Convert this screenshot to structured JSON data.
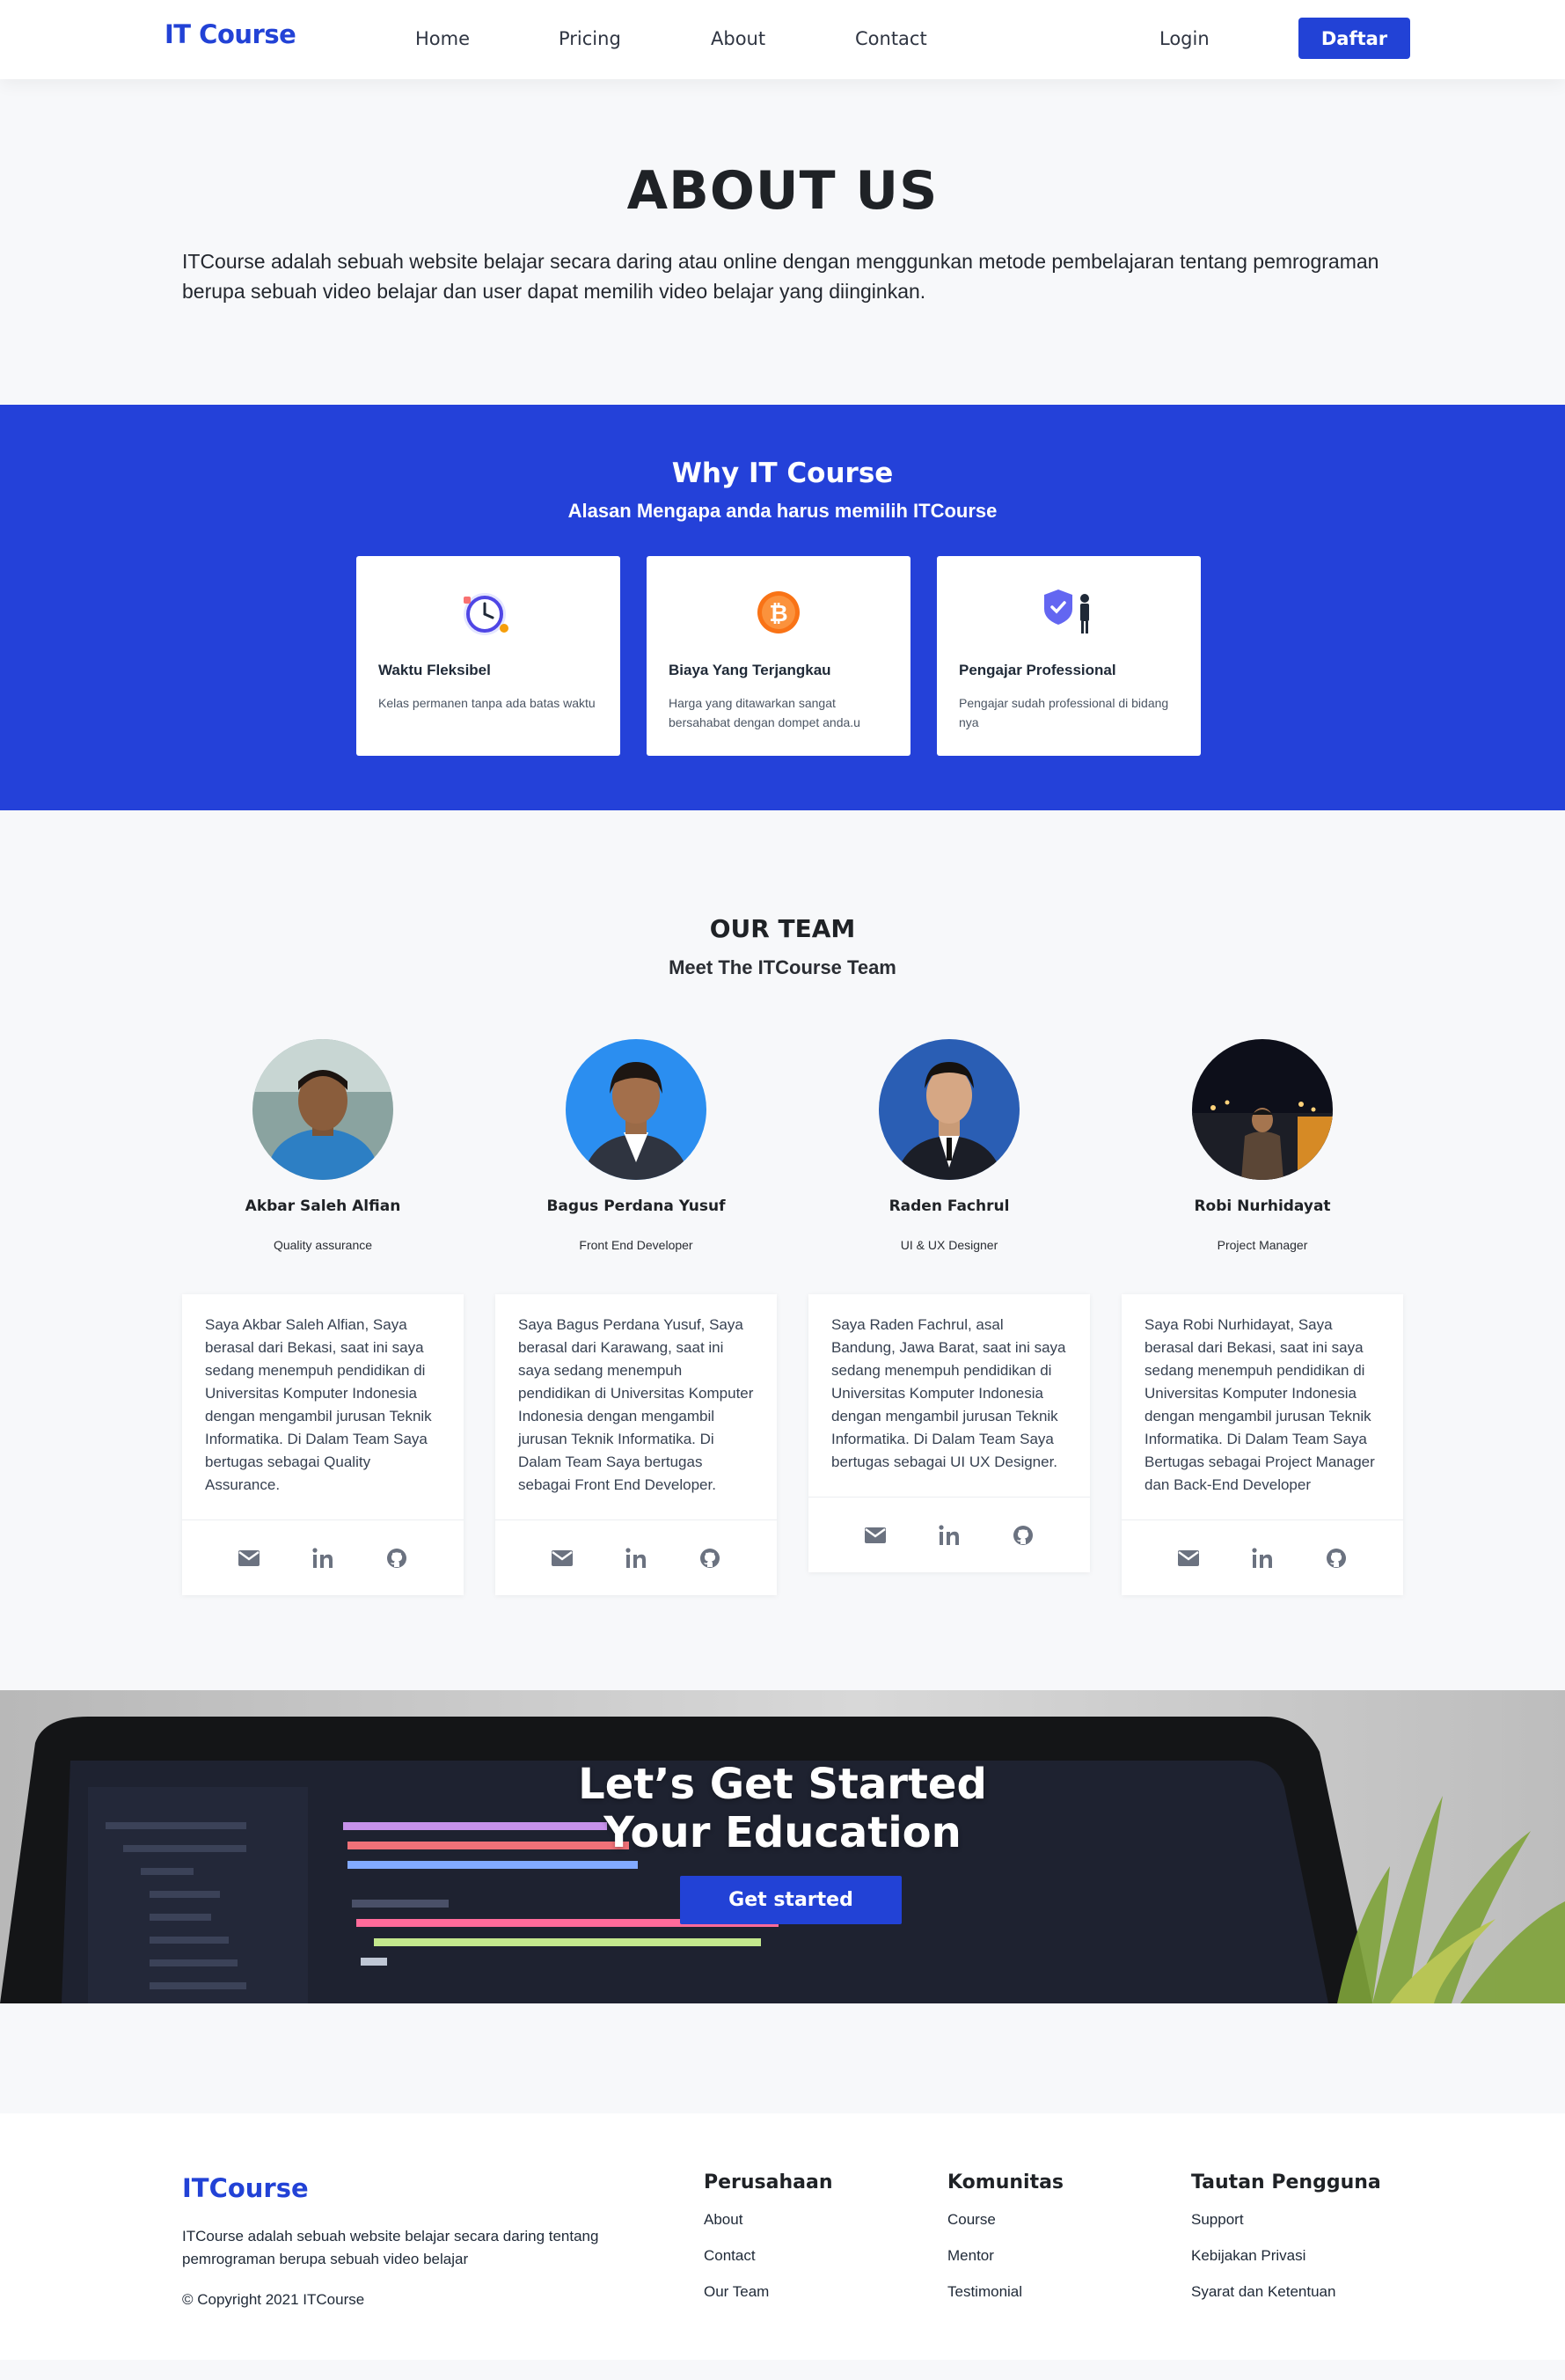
{
  "nav": {
    "brand": "IT Course",
    "links": [
      "Home",
      "Pricing",
      "About",
      "Contact"
    ],
    "login": "Login",
    "register": "Daftar"
  },
  "about": {
    "title": "ABOUT US",
    "text": "ITCourse adalah sebuah website belajar secara daring atau online dengan menggunkan metode pembelajaran tentang pemrograman berupa sebuah video belajar dan user dapat memilih video belajar yang diinginkan."
  },
  "why": {
    "title": "Why IT Course",
    "subtitle": "Alasan Mengapa anda harus memilih ITCourse",
    "features": [
      {
        "icon": "clock-icon",
        "title": "Waktu Fleksibel",
        "desc": "Kelas permanen tanpa ada batas waktu"
      },
      {
        "icon": "bitcoin-icon",
        "title": "Biaya Yang Terjangkau",
        "desc": "Harga yang ditawarkan sangat bersahabat dengan dompet anda.u"
      },
      {
        "icon": "shield-person-icon",
        "title": "Pengajar Professional",
        "desc": "Pengajar sudah professional di bidang nya"
      }
    ]
  },
  "team": {
    "title": "OUR TEAM",
    "subtitle": "Meet The ITCourse Team",
    "members": [
      {
        "name": "Akbar Saleh Alfian",
        "role": "Quality assurance",
        "bio": "Saya Akbar Saleh Alfian, Saya berasal dari Bekasi, saat ini saya sedang menempuh pendidikan di Universitas Komputer Indonesia dengan mengambil jurusan Teknik Informatika. Di Dalam Team Saya bertugas sebagai Quality Assurance."
      },
      {
        "name": "Bagus Perdana Yusuf",
        "role": "Front End Developer",
        "bio": "Saya Bagus Perdana Yusuf, Saya berasal dari Karawang, saat ini saya sedang menempuh pendidikan di Universitas Komputer Indonesia dengan mengambil jurusan Teknik Informatika. Di Dalam Team Saya bertugas sebagai Front End Developer."
      },
      {
        "name": "Raden Fachrul",
        "role": "UI & UX Designer",
        "bio": "Saya Raden Fachrul, asal Bandung, Jawa Barat, saat ini saya sedang menempuh pendidikan di Universitas Komputer Indonesia dengan mengambil jurusan Teknik Informatika. Di Dalam Team Saya bertugas sebagai UI UX Designer."
      },
      {
        "name": "Robi Nurhidayat",
        "role": "Project Manager",
        "bio": "Saya Robi Nurhidayat, Saya berasal dari Bekasi, saat ini saya sedang menempuh pendidikan di Universitas Komputer Indonesia dengan mengambil jurusan Teknik Informatika. Di Dalam Team Saya Bertugas sebagai Project Manager dan Back-End Developer"
      }
    ]
  },
  "hero": {
    "line1": "Let’s Get Started",
    "line2": "Your Education",
    "cta": "Get started"
  },
  "footer": {
    "brand": "ITCourse",
    "desc": "ITCourse adalah sebuah website belajar secara daring tentang pemrograman berupa sebuah video belajar",
    "copyright": "© Copyright 2021 ITCourse",
    "columns": [
      {
        "title": "Perusahaan",
        "links": [
          "About",
          "Contact",
          "Our Team"
        ]
      },
      {
        "title": "Komunitas",
        "links": [
          "Course",
          "Mentor",
          "Testimonial"
        ]
      },
      {
        "title": "Tautan Pengguna",
        "links": [
          "Support",
          "Kebijakan Privasi",
          "Syarat dan Ketentuan"
        ]
      }
    ]
  },
  "colors": {
    "accent": "#2242d6",
    "section_blue": "#2441d9"
  }
}
